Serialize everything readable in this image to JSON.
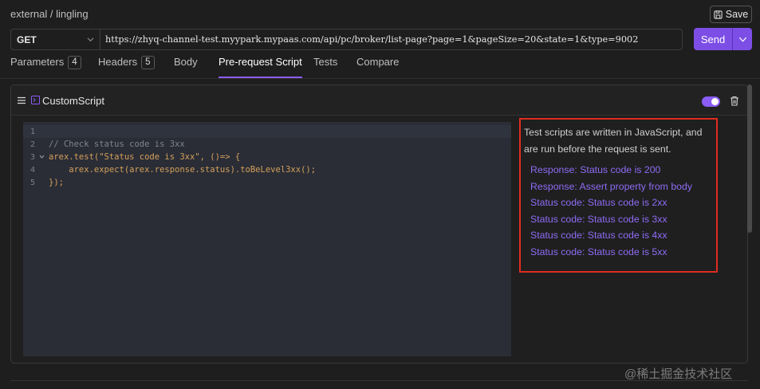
{
  "breadcrumb": "external / lingling",
  "toolbar": {
    "save_label": "Save"
  },
  "request": {
    "method": "GET",
    "url": "https://zhyq-channel-test.myypark.mypaas.com/api/pc/broker/list-page?page=1&pageSize=20&state=1&type=9002",
    "send_label": "Send"
  },
  "tabs": [
    {
      "label": "Parameters",
      "count": "4"
    },
    {
      "label": "Headers",
      "count": "5"
    },
    {
      "label": "Body"
    },
    {
      "label": "Pre-request Script",
      "active": true
    },
    {
      "label": "Tests"
    },
    {
      "label": "Compare"
    }
  ],
  "script_card": {
    "title": "CustomScript",
    "enabled": true
  },
  "code": {
    "line_numbers": [
      "1",
      "2",
      "3",
      "4",
      "5"
    ],
    "lines": [
      "",
      "// Check status code is 3xx",
      "arex.test(\"Status code is 3xx\", ()=> {",
      "    arex.expect(arex.response.status).toBeLevel3xx();",
      "});"
    ]
  },
  "hint": {
    "text": "Test scripts are written in JavaScript, and are run before the request is sent.",
    "snippets": [
      "Response: Status code is 200",
      "Response: Assert property from body",
      "Status code: Status code is 2xx",
      "Status code: Status code is 3xx",
      "Status code: Status code is 4xx",
      "Status code: Status code is 5xx"
    ]
  },
  "watermark": "@稀土掘金技术社区",
  "colors": {
    "accent": "#8b5cf6",
    "highlight_box": "#e02b20",
    "background": "#1e1e1e"
  }
}
